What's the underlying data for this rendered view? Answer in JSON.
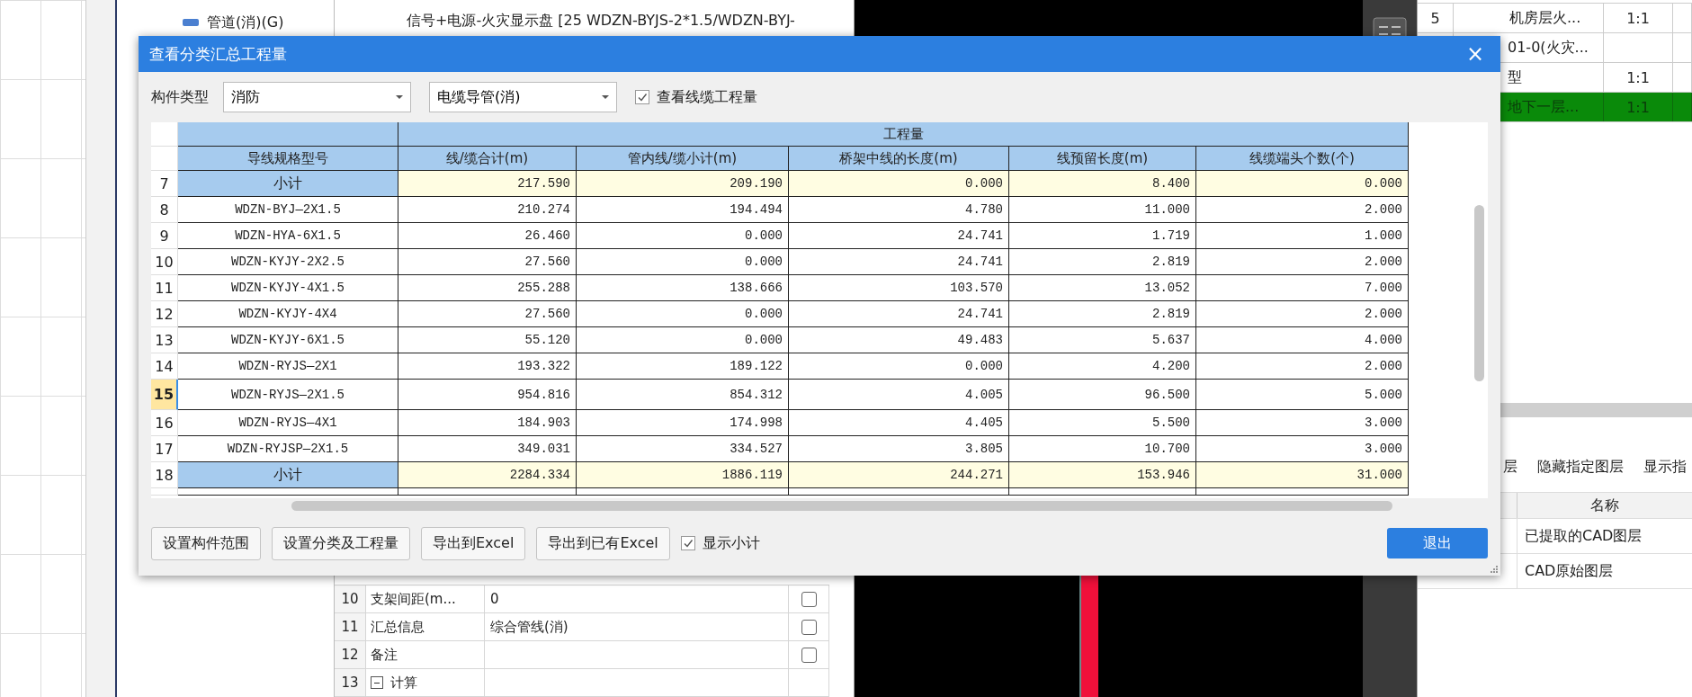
{
  "background": {
    "tree_items": [
      {
        "label": "管道(消)(G)"
      }
    ],
    "list_lines": [
      "信号+电源-火灾显示盘 [25 WDZN-BYJS-2*1.5/WDZN-BYJ-"
    ],
    "properties": [
      {
        "number": "10",
        "name": "支架间距(m...",
        "value": "0",
        "kind": "field",
        "checked": false
      },
      {
        "number": "11",
        "name": "汇总信息",
        "value": "综合管线(消)",
        "kind": "field",
        "checked": false
      },
      {
        "number": "12",
        "name": "备注",
        "kind": "field",
        "checked": false
      },
      {
        "number": "13",
        "name": "计算",
        "kind": "group",
        "expanded": true
      }
    ],
    "floor_table": [
      {
        "number": "5",
        "name": "机房层火...",
        "scale": "1:1",
        "selected": false
      },
      {
        "name": "01-0(火灾...",
        "selected": false
      },
      {
        "name": "型",
        "scale": "1:1",
        "selected": false
      },
      {
        "name": "地下一层...",
        "scale": "1:1",
        "selected": true
      }
    ],
    "layer_toolbar": [
      "层",
      "隐藏指定图层",
      "显示指"
    ],
    "layer_table": {
      "column": "名称",
      "rows": [
        {
          "name": "已提取的CAD图层"
        },
        {
          "name": "CAD原始图层"
        }
      ]
    }
  },
  "dialog": {
    "title": "查看分类汇总工程量",
    "close": "×",
    "filter": {
      "label": "构件类型",
      "selects": [
        {
          "value": "消防"
        },
        {
          "value": "电缆导管(消)"
        }
      ],
      "checkbox": {
        "label": "查看线缆工程量",
        "checked": true
      }
    },
    "table": {
      "group_header": "工程量",
      "columns": [
        "导线规格型号",
        "线/缆合计(m)",
        "管内线/缆小计(m)",
        "桥架中线的长度(m)",
        "线预留长度(m)",
        "线缆端头个数(个)"
      ],
      "rows": [
        {
          "number": "7",
          "kind": "subtotal",
          "selected": false,
          "cells": [
            "小计",
            "217.590",
            "209.190",
            "0.000",
            "8.400",
            "0.000"
          ]
        },
        {
          "number": "8",
          "kind": "item",
          "selected": false,
          "cells": [
            "WDZN-BYJ—2X1.5",
            "210.274",
            "194.494",
            "4.780",
            "11.000",
            "2.000"
          ]
        },
        {
          "number": "9",
          "kind": "item",
          "selected": false,
          "cells": [
            "WDZN-HYA-6X1.5",
            "26.460",
            "0.000",
            "24.741",
            "1.719",
            "1.000"
          ]
        },
        {
          "number": "10",
          "kind": "item",
          "selected": false,
          "cells": [
            "WDZN-KYJY-2X2.5",
            "27.560",
            "0.000",
            "24.741",
            "2.819",
            "2.000"
          ]
        },
        {
          "number": "11",
          "kind": "item",
          "selected": false,
          "cells": [
            "WDZN-KYJY-4X1.5",
            "255.288",
            "138.666",
            "103.570",
            "13.052",
            "7.000"
          ]
        },
        {
          "number": "12",
          "kind": "item",
          "selected": false,
          "cells": [
            "WDZN-KYJY-4X4",
            "27.560",
            "0.000",
            "24.741",
            "2.819",
            "2.000"
          ]
        },
        {
          "number": "13",
          "kind": "item",
          "selected": false,
          "cells": [
            "WDZN-KYJY-6X1.5",
            "55.120",
            "0.000",
            "49.483",
            "5.637",
            "4.000"
          ]
        },
        {
          "number": "14",
          "kind": "item",
          "selected": false,
          "cells": [
            "WDZN-RYJS—2X1",
            "193.322",
            "189.122",
            "0.000",
            "4.200",
            "2.000"
          ]
        },
        {
          "number": "15",
          "kind": "item",
          "selected": true,
          "cells": [
            "WDZN-RYJS—2X1.5",
            "954.816",
            "854.312",
            "4.005",
            "96.500",
            "5.000"
          ]
        },
        {
          "number": "16",
          "kind": "item",
          "selected": false,
          "cells": [
            "WDZN-RYJS—4X1",
            "184.903",
            "174.998",
            "4.405",
            "5.500",
            "3.000"
          ]
        },
        {
          "number": "17",
          "kind": "item",
          "selected": false,
          "cells": [
            "WDZN-RYJSP—2X1.5",
            "349.031",
            "334.527",
            "3.805",
            "10.700",
            "3.000"
          ]
        },
        {
          "number": "18",
          "kind": "subtotal",
          "selected": false,
          "cells": [
            "小计",
            "2284.334",
            "1886.119",
            "244.271",
            "153.946",
            "31.000"
          ]
        }
      ]
    },
    "buttons": [
      {
        "label": "设置构件范围"
      },
      {
        "label": "设置分类及工程量"
      },
      {
        "label": "导出到Excel"
      },
      {
        "label": "导出到已有Excel"
      }
    ],
    "subtotal_checkbox": {
      "label": "显示小计",
      "checked": true
    },
    "exit": "退出"
  }
}
